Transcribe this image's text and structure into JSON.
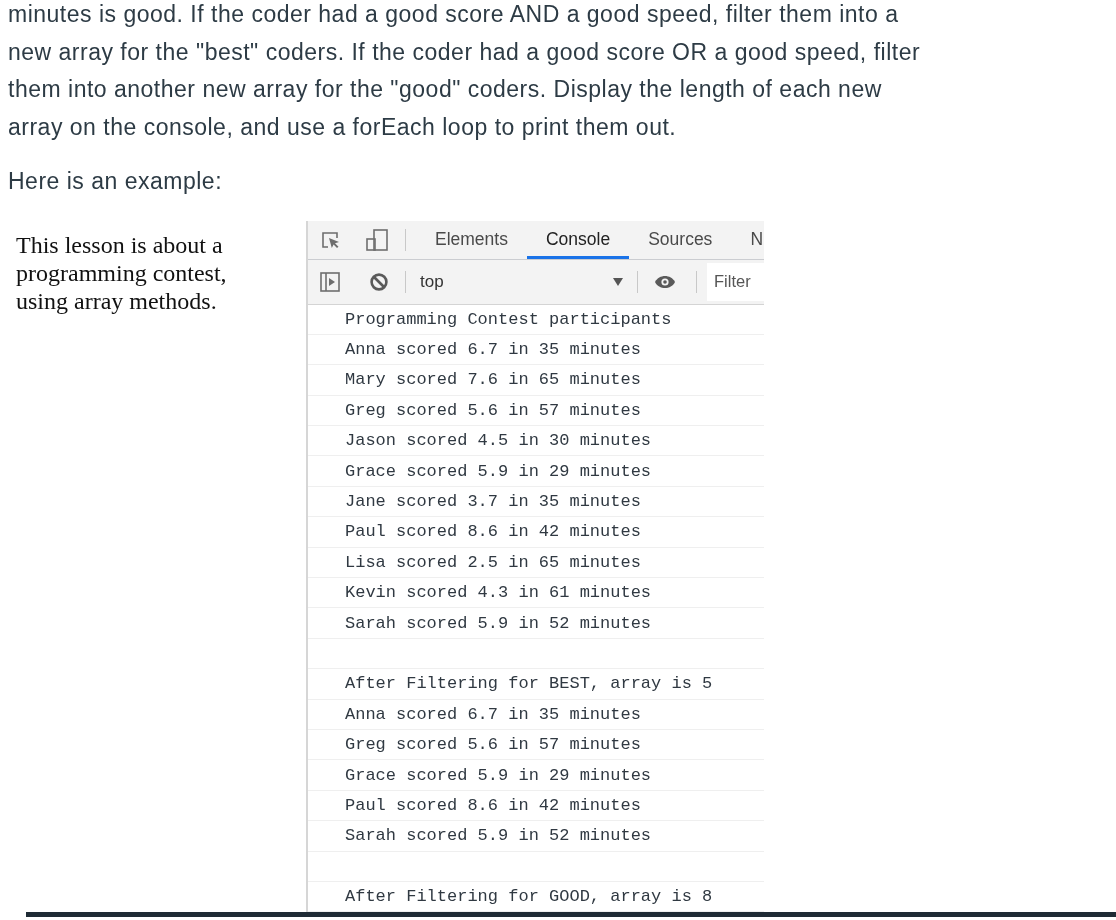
{
  "instructions": {
    "paragraphs": [
      "minutes is good. If the coder had a good score AND a good speed, filter them into a new array for the \"best\" coders. If the coder had a good score OR a good speed, filter them into another new array for the \"good\" coders. Display the length of each new array on the console, and use a forEach loop to print them out.",
      "Here is an example:"
    ]
  },
  "example": {
    "page_text": "This lesson is about a programming contest, using array methods.",
    "devtools": {
      "tabs": [
        {
          "label": "Elements",
          "selected": false
        },
        {
          "label": "Console",
          "selected": true
        },
        {
          "label": "Sources",
          "selected": false
        },
        {
          "label": "N",
          "selected": false
        }
      ],
      "context": "top",
      "filter": {
        "placeholder": "Filter"
      },
      "console_lines": [
        {
          "kind": "log",
          "text": "Programming Contest participants"
        },
        {
          "kind": "log",
          "text": "Anna scored 6.7 in 35 minutes"
        },
        {
          "kind": "log",
          "text": "Mary scored 7.6 in 65 minutes"
        },
        {
          "kind": "log",
          "text": "Greg scored 5.6 in 57 minutes"
        },
        {
          "kind": "log",
          "text": "Jason scored 4.5 in 30 minutes"
        },
        {
          "kind": "log",
          "text": "Grace scored 5.9 in 29 minutes"
        },
        {
          "kind": "log",
          "text": "Jane scored 3.7 in 35 minutes"
        },
        {
          "kind": "log",
          "text": "Paul scored 8.6 in 42 minutes"
        },
        {
          "kind": "log",
          "text": "Lisa scored 2.5 in 65 minutes"
        },
        {
          "kind": "log",
          "text": "Kevin scored 4.3 in 61 minutes"
        },
        {
          "kind": "log",
          "text": "Sarah scored 5.9 in 52 minutes"
        },
        {
          "kind": "blank"
        },
        {
          "kind": "log",
          "text": "After Filtering for BEST, array is 5"
        },
        {
          "kind": "log",
          "text": "Anna scored 6.7 in 35 minutes"
        },
        {
          "kind": "log",
          "text": "Greg scored 5.6 in 57 minutes"
        },
        {
          "kind": "log",
          "text": "Grace scored 5.9 in 29 minutes"
        },
        {
          "kind": "log",
          "text": "Paul scored 8.6 in 42 minutes"
        },
        {
          "kind": "log",
          "text": "Sarah scored 5.9 in 52 minutes"
        },
        {
          "kind": "blank"
        },
        {
          "kind": "log",
          "text": "After Filtering for GOOD, array is 8"
        }
      ]
    }
  }
}
